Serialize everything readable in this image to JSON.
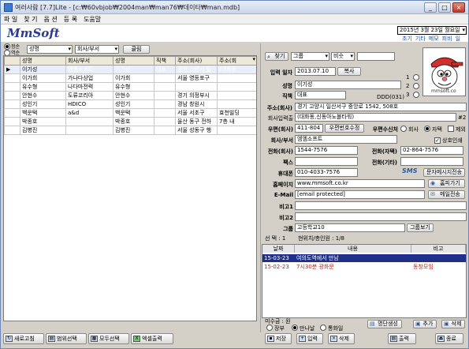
{
  "window": {
    "title": "여러사람 [7.7]Lite - [c:₩60vbjob₩2004man₩man76₩데이타₩man.mdb]",
    "minimize": "_",
    "maximize": "□",
    "close": "×"
  },
  "menu": [
    "파 일",
    "찾 기",
    "옵 션",
    "등 록",
    "도움말"
  ],
  "logo": "MmSoft",
  "date": {
    "value": "2015년  3월 23일 월요일",
    "toplinks": [
      "초기",
      "기타",
      "메모",
      "회비",
      "일정"
    ]
  },
  "search": {
    "radio_top": "정순",
    "radio_bottom": "역순",
    "field": "성명",
    "field2": "회사/부서",
    "clear_label": "클림",
    "find_label": "찾기",
    "group_select": "그룹",
    "compare_select": "비슷",
    "search_value": ""
  },
  "list": {
    "columns": [
      "성명",
      "회사/부서",
      "성명",
      "직책",
      "주소(회사)",
      "주소(회"
    ],
    "rows": [
      [
        "이기성",
        "엠엠소프트",
        "이기성",
        "대표",
        "경기 고양시 일",
        "(대화동"
      ],
      [
        "이가희",
        "가나다상업",
        "이가희",
        "",
        "서울 영등포구",
        ""
      ],
      [
        "유수형",
        "나다마전력",
        "유수형",
        "",
        "",
        ""
      ],
      [
        "안현수",
        "도류코리아",
        "안현수",
        "",
        "경기 의정부시",
        ""
      ],
      [
        "성인기",
        "HDICO",
        "성인기",
        "",
        "경남 창원시",
        ""
      ],
      [
        "백운택",
        "a&d",
        "백운택",
        "",
        "서울 서초구",
        "효천빌딩"
      ],
      [
        "박종호",
        "",
        "박종호",
        "",
        "울산 동구 전하",
        "7층 내"
      ],
      [
        "김병진",
        "",
        "김병진",
        "",
        "서울 성동구 행",
        ""
      ]
    ]
  },
  "left_buttons": [
    "새로고침",
    "범위선택",
    "모두선택",
    "엑셀출력"
  ],
  "detail": {
    "input_date_label": "입력 일자",
    "input_date": "2013.07.10",
    "copy_label": "복사",
    "name_label": "성명",
    "name": "이기성",
    "title_label": "직책",
    "title": "대표",
    "ddd_label": "DDD(031)",
    "side_nums": [
      "1",
      "2",
      "3"
    ],
    "photo_caption": "mmsoft.co",
    "addr_company_label": "주소(회사)",
    "addr_company": "경기 고양시 일산서구 중앙로 1542, 508호",
    "addr_detail_label": "회사입력출",
    "addr_detail": "(대화동,신동아노블타워)",
    "addr_tag": "#2",
    "zip_label": "우편(회사)",
    "zip": "411-804",
    "zip_btn": "우편번호수정",
    "mail_recv_label": "우편수신처",
    "mail_recv_options": [
      "회사",
      "자택",
      "제외"
    ],
    "company_label": "회사/부서",
    "company": "엠엠소프트",
    "company_check": "상호인쇄",
    "tel_company_label": "전화(회사)",
    "tel_company": "1544-7576",
    "tel_home_label": "전화(자택)",
    "tel_home": "02-864-7576",
    "fax_label": "팩스",
    "fax": "",
    "tel_other_label": "전화(기타)",
    "tel_other": "",
    "mobile_label": "휴대폰",
    "mobile": "010-4033-7576",
    "sms_label": "SMS",
    "sms_btn": "문자메시지전송",
    "homepage_label": "홈페이지",
    "homepage": "www.mmsoft.co.kr",
    "home_btn": "홈피가기",
    "email_label": "E-Mail",
    "email": "[email protected]",
    "mail_btn": "메일전송",
    "note1_label": "비고1",
    "note1": "",
    "note2_label": "비고2",
    "note2": "",
    "group_label": "그룹",
    "group": "고등학교10",
    "group_view_btn": "그룹보기",
    "status": "선 택 : 1       현위치/총인원 : 1/8"
  },
  "schedule": {
    "headers": [
      "날짜",
      "내용",
      "비고"
    ],
    "rows": [
      {
        "date": "15-03-23",
        "content": "여의도역에서 만남",
        "note": "",
        "selected": true
      },
      {
        "date": "15-02-23",
        "content": "7시30분 광화문",
        "note": "동창모임",
        "selected": false
      }
    ],
    "note_label": "미수금 : 원",
    "view_options": [
      "장부",
      "만나날",
      "통화일"
    ],
    "buttons": [
      "명단생성",
      "추가",
      "삭제"
    ]
  },
  "bottom_buttons": [
    "저장",
    "입력",
    "삭제",
    "출력",
    "종료"
  ],
  "colors": {
    "accent": "#2c5aa0",
    "link": "#1a55a8",
    "panel": "#d4d0c8"
  }
}
